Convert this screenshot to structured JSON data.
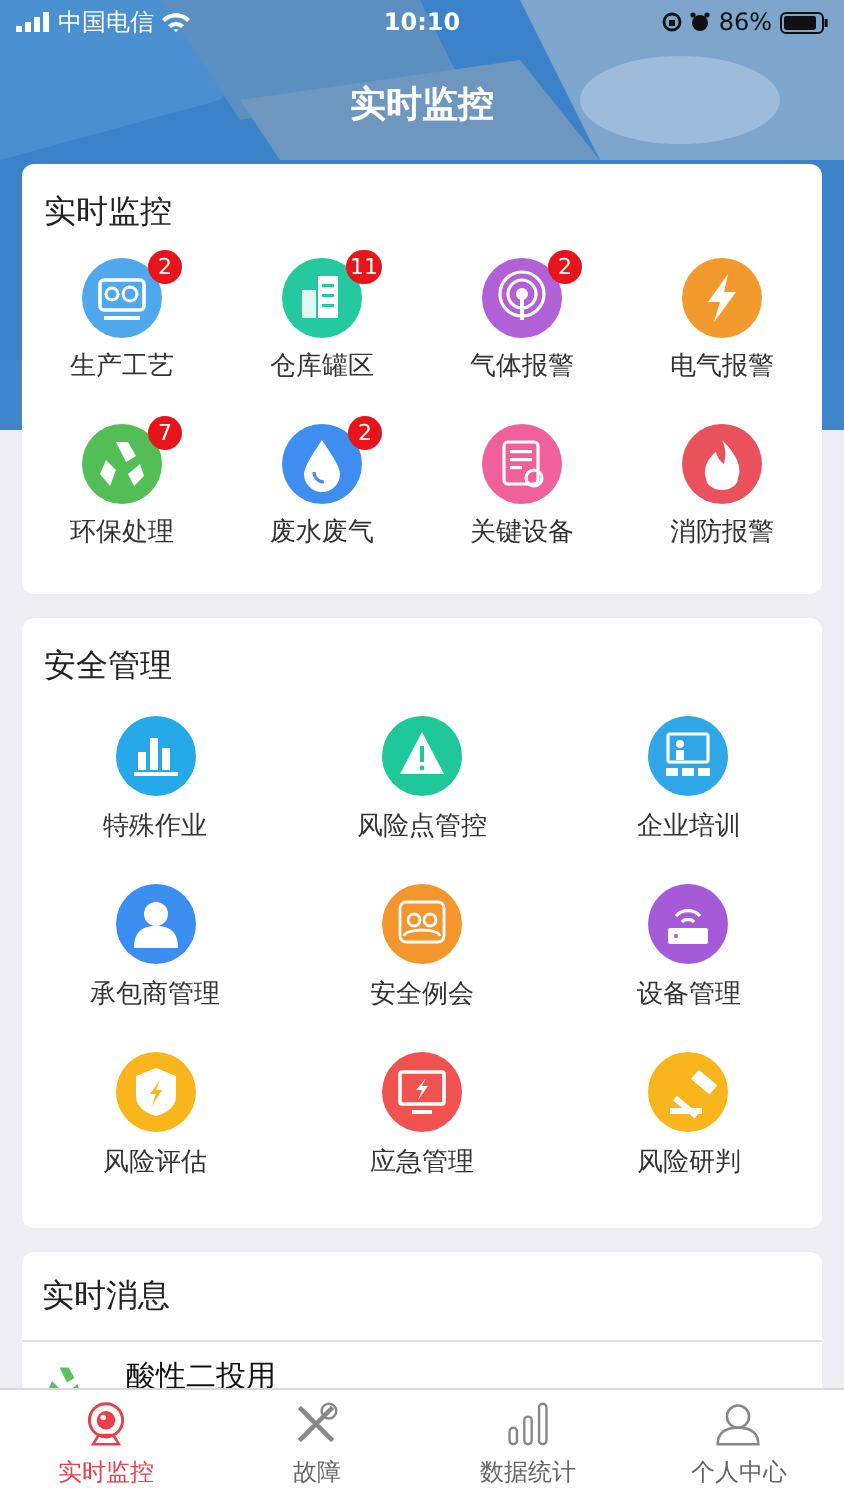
{
  "status_bar": {
    "carrier": "中国电信",
    "time": "10:10",
    "battery": "86%"
  },
  "header": {
    "title": "实时监控"
  },
  "monitor": {
    "title": "实时监控",
    "items": [
      {
        "label": "生产工艺",
        "badge": "2",
        "color": "#4fa8ec"
      },
      {
        "label": "仓库罐区",
        "badge": "11",
        "color": "#25c9a0"
      },
      {
        "label": "气体报警",
        "badge": "2",
        "color": "#b260d6"
      },
      {
        "label": "电气报警",
        "color": "#f39a2e"
      },
      {
        "label": "环保处理",
        "badge": "7",
        "color": "#52be55"
      },
      {
        "label": "废水废气",
        "badge": "2",
        "color": "#3d8ef0"
      },
      {
        "label": "关键设备",
        "color": "#f0609a"
      },
      {
        "label": "消防报警",
        "color": "#e9525c"
      }
    ]
  },
  "safety": {
    "title": "安全管理",
    "items": [
      {
        "label": "特殊作业",
        "color": "#25a9e8"
      },
      {
        "label": "风险点管控",
        "color": "#1fc898"
      },
      {
        "label": "企业培训",
        "color": "#2fa6e6"
      },
      {
        "label": "承包商管理",
        "color": "#3b8ef0"
      },
      {
        "label": "安全例会",
        "color": "#f5952e"
      },
      {
        "label": "设备管理",
        "color": "#a55bd8"
      },
      {
        "label": "风险评估",
        "color": "#f8b51c"
      },
      {
        "label": "应急管理",
        "color": "#f05250"
      },
      {
        "label": "风险研判",
        "color": "#f8b51c"
      }
    ]
  },
  "messages": {
    "title": "实时消息",
    "items": [
      {
        "text": "酸性二投用"
      }
    ]
  },
  "tab_bar": [
    {
      "label": "实时监控",
      "selected": true
    },
    {
      "label": "故障",
      "selected": false
    },
    {
      "label": "数据统计",
      "selected": false
    },
    {
      "label": "个人中心",
      "selected": false
    }
  ]
}
